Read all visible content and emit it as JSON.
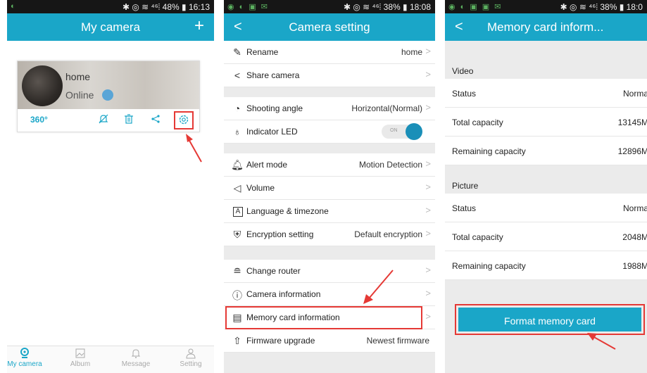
{
  "panel1": {
    "status": {
      "left_icons": "◐",
      "right": "✱ ◎ ≋ ⁴⁶⦙ 48% ▮ 16:13"
    },
    "title": "My camera",
    "add_icon": "plus-icon",
    "camera": {
      "name": "home",
      "status": "Online",
      "pano_label": "360°"
    },
    "nav": [
      {
        "label": "My camera",
        "icon": "camera-icon"
      },
      {
        "label": "Album",
        "icon": "album-icon"
      },
      {
        "label": "Message",
        "icon": "bell-icon"
      },
      {
        "label": "Setting",
        "icon": "person-icon"
      }
    ]
  },
  "panel2": {
    "status": {
      "left_icons": "◉ ◐ ▣ ✉",
      "right": "✱ ◎ ≋ ⁴⁶⦙ 38% ▮ 18:08"
    },
    "title": "Camera setting",
    "rows": {
      "rename": {
        "label": "Rename",
        "value": "home"
      },
      "share": {
        "label": "Share camera"
      },
      "angle": {
        "label": "Shooting angle",
        "value": "Horizontal(Normal)"
      },
      "led": {
        "label": "Indicator LED",
        "toggle": "ON"
      },
      "alert": {
        "label": "Alert mode",
        "value": "Motion Detection"
      },
      "volume": {
        "label": "Volume"
      },
      "language": {
        "label": "Language & timezone"
      },
      "encryption": {
        "label": "Encryption setting",
        "value": "Default encryption"
      },
      "router": {
        "label": "Change router"
      },
      "caminfo": {
        "label": "Camera information"
      },
      "memcard": {
        "label": "Memory card information"
      },
      "firmware": {
        "label": "Firmware upgrade",
        "value": "Newest firmware"
      }
    }
  },
  "panel3": {
    "status": {
      "left_icons": "◉ ◐ ▣ ▣ ✉",
      "right": "✱ ◎ ≋ ⁴⁶⦙ 38% ▮ 18:0"
    },
    "title": "Memory card inform...",
    "video": {
      "heading": "Video",
      "status_label": "Status",
      "status_value": "Norma",
      "total_label": "Total capacity",
      "total_value": "13145M",
      "remaining_label": "Remaining capacity",
      "remaining_value": "12896M"
    },
    "picture": {
      "heading": "Picture",
      "status_label": "Status",
      "status_value": "Norma",
      "total_label": "Total capacity",
      "total_value": "2048M",
      "remaining_label": "Remaining capacity",
      "remaining_value": "1988M"
    },
    "format_button": "Format memory card"
  },
  "colors": {
    "accent": "#1aa6c8",
    "annotation": "#e53935"
  }
}
